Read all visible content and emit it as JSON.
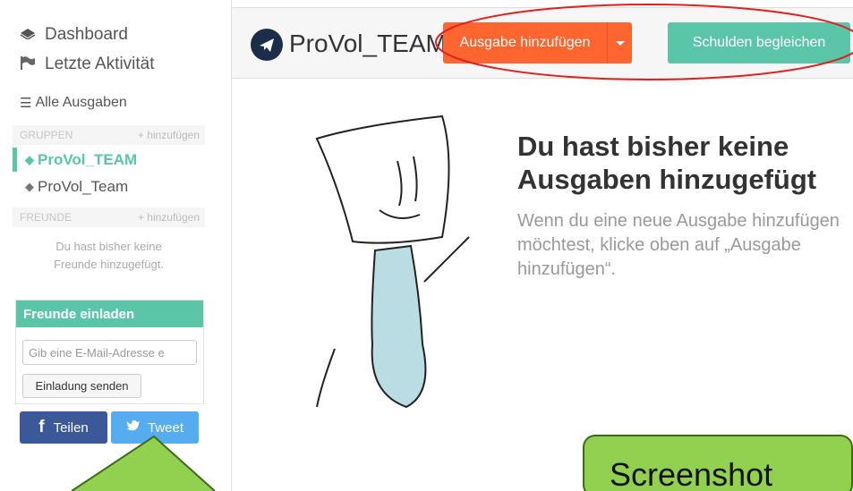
{
  "sidebar": {
    "dashboard": "Dashboard",
    "recent": "Letzte Aktivität",
    "all_expenses": "Alle Ausgaben",
    "groups_header": "GRUPPEN",
    "groups_add": "+ hinzufügen",
    "groups": [
      {
        "label": "ProVol_TEAM",
        "active": true
      },
      {
        "label": "ProVol_Team",
        "active": false
      }
    ],
    "friends_header": "FREUNDE",
    "friends_add": "+ hinzufügen",
    "no_friends_line1": "Du hast bisher keine",
    "no_friends_line2": "Freunde hinzugefügt.",
    "invite": {
      "title": "Freunde einladen",
      "placeholder": "Gib eine E-Mail-Adresse e",
      "send": "Einladung senden"
    },
    "share_facebook": "Teilen",
    "share_twitter": "Tweet"
  },
  "topbar": {
    "group_name": "ProVol_TEAM",
    "add_expense": "Ausgabe hinzufügen",
    "settle_up": "Schulden begleichen"
  },
  "empty_state": {
    "title": "Du hast bisher keine Ausgaben hinzugefügt",
    "text": "Wenn du eine neue Ausgabe hinzufügen möchtest, klicke oben auf „Ausgabe hinzufügen“."
  },
  "annotation": {
    "label": "Screenshot"
  },
  "colors": {
    "brand_green": "#5bc5a7",
    "accent_orange": "#ff652f",
    "facebook": "#3b5998",
    "twitter": "#55acee",
    "highlight_red": "#e02020",
    "callout_green": "#92d050"
  },
  "icons": {
    "dashboard": "dashboard-icon",
    "recent": "flag-icon",
    "all_expenses": "list-icon",
    "group_tag": "tag-icon",
    "group_avatar": "airplane-icon"
  }
}
